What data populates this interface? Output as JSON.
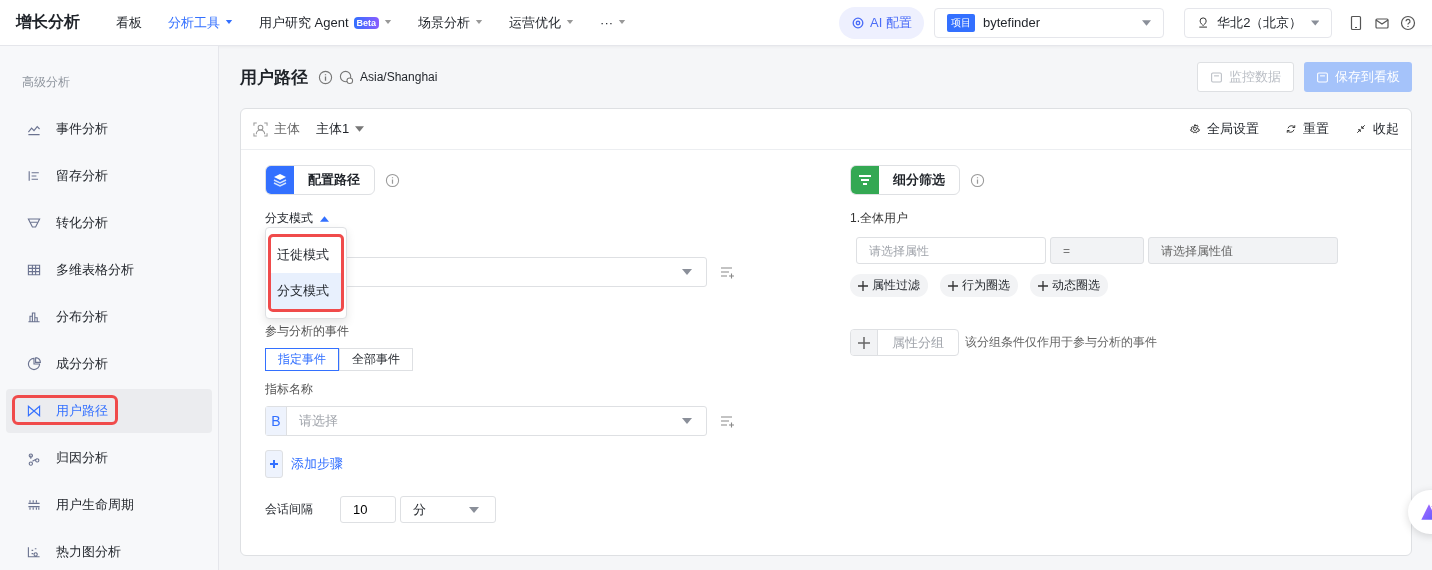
{
  "app": {
    "title": "增长分析"
  },
  "nav": [
    {
      "label": "看板",
      "selected": false,
      "has_menu": false
    },
    {
      "label": "分析工具",
      "selected": true,
      "has_menu": true
    },
    {
      "label": "用户研究 Agent",
      "badge": "Beta",
      "selected": false,
      "has_menu": true
    },
    {
      "label": "场景分析",
      "selected": false,
      "has_menu": true
    },
    {
      "label": "运营优化",
      "selected": false,
      "has_menu": true
    },
    {
      "label": "···",
      "selected": false,
      "has_menu": true
    }
  ],
  "ai_config": "AI 配置",
  "project": {
    "tag": "项目",
    "value": "bytefinder"
  },
  "region": "华北2（北京）",
  "sidebar": {
    "section": "高级分析",
    "items": [
      {
        "label": "事件分析",
        "selected": false
      },
      {
        "label": "留存分析",
        "selected": false
      },
      {
        "label": "转化分析",
        "selected": false
      },
      {
        "label": "多维表格分析",
        "selected": false
      },
      {
        "label": "分布分析",
        "selected": false
      },
      {
        "label": "成分分析",
        "selected": false
      },
      {
        "label": "用户路径",
        "selected": true
      },
      {
        "label": "归因分析",
        "selected": false
      },
      {
        "label": "用户生命周期",
        "selected": false
      },
      {
        "label": "热力图分析",
        "selected": false
      }
    ]
  },
  "page": {
    "title": "用户路径",
    "timezone": "Asia/Shanghai",
    "buttons": [
      {
        "label": "监控数据",
        "kind": "secondary",
        "disabled": true
      },
      {
        "label": "保存到看板",
        "kind": "primary",
        "disabled": true
      }
    ]
  },
  "subject": {
    "label": "主体",
    "value": "主体1"
  },
  "toolbar": [
    "全局设置",
    "重置",
    "收起"
  ],
  "path_config": {
    "title": "配置路径",
    "mode_label": "分支模式",
    "mode_expanded": true,
    "mode_options": [
      {
        "label": "迁徙模式",
        "selected": false
      },
      {
        "label": "分支模式",
        "selected": true
      }
    ],
    "events_label": "参与分析的事件",
    "event_tabs": [
      {
        "label": "指定事件",
        "selected": true
      },
      {
        "label": "全部事件",
        "selected": false
      }
    ],
    "metric_label": "指标名称",
    "step_letter": "B",
    "step_placeholder": "请选择",
    "add_step": "添加步骤",
    "session_label": "会话间隔",
    "session_value": "10",
    "session_unit": "分"
  },
  "filter": {
    "title": "细分筛选",
    "group": "1.全体用户",
    "property_placeholder": "请选择属性",
    "operator": "=",
    "value_placeholder": "请选择属性值",
    "actions": [
      "属性过滤",
      "行为圈选",
      "动态圈选"
    ],
    "group_by": "属性分组",
    "group_by_note": "该分组条件仅作用于参与分析的事件"
  }
}
